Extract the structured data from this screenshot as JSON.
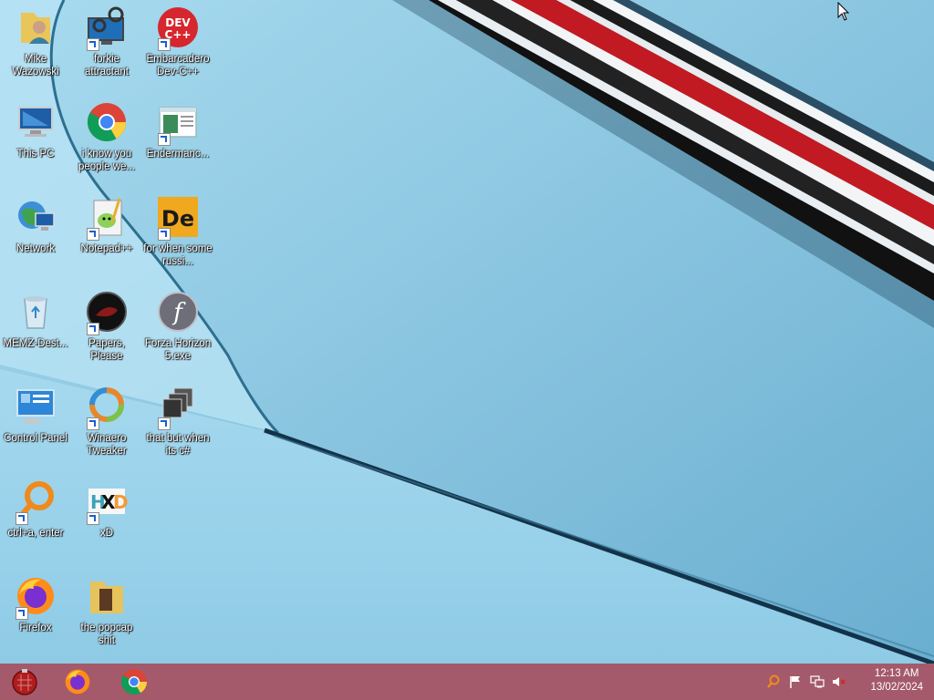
{
  "desktop": {
    "icons": [
      {
        "label": "Mike Wazowski",
        "icon": "user-folder-icon"
      },
      {
        "label": "forkie attractant",
        "icon": "computer-gear-icon"
      },
      {
        "label": "Embarcadero Dev-C++",
        "icon": "devcpp-icon"
      },
      {
        "label": "This PC",
        "icon": "this-pc-icon"
      },
      {
        "label": "i know you people we...",
        "icon": "chrome-icon"
      },
      {
        "label": "Endermanc...",
        "icon": "window-app-icon"
      },
      {
        "label": "Network",
        "icon": "network-icon"
      },
      {
        "label": "Notepad++",
        "icon": "notepadpp-icon"
      },
      {
        "label": "for when some russi...",
        "icon": "de-app-icon"
      },
      {
        "label": "MEMZ-Dest...",
        "icon": "recycle-bin-icon"
      },
      {
        "label": "Papers, Please",
        "icon": "papers-please-icon"
      },
      {
        "label": "Forza Horizon 5.exe",
        "icon": "flash-icon"
      },
      {
        "label": "Control Panel",
        "icon": "control-panel-icon"
      },
      {
        "label": "Winaero Tweaker",
        "icon": "winaero-icon"
      },
      {
        "label": "that but when its c#",
        "icon": "stacked-windows-icon"
      },
      {
        "label": "ctrl+a, enter",
        "icon": "magnifier-icon"
      },
      {
        "label": "xD",
        "icon": "hxd-icon"
      },
      {
        "label": "Firefox",
        "icon": "firefox-icon"
      },
      {
        "label": "the popcap shit",
        "icon": "folder-icon"
      }
    ]
  },
  "taskbar": {
    "start_icon": "start-orb-icon",
    "pinned": [
      {
        "name": "Firefox",
        "icon": "firefox-icon"
      },
      {
        "name": "Google Chrome",
        "icon": "chrome-icon"
      }
    ],
    "tray": {
      "icons": [
        "magnifier-tray-icon",
        "flag-icon",
        "network-tray-icon",
        "volume-muted-icon"
      ],
      "time": "12:13 AM",
      "date": "13/02/2024"
    }
  },
  "colors": {
    "taskbar": "#a45a6a",
    "wallpaper_blue": "#7dbcd9",
    "stripe_red": "#c21a22"
  }
}
